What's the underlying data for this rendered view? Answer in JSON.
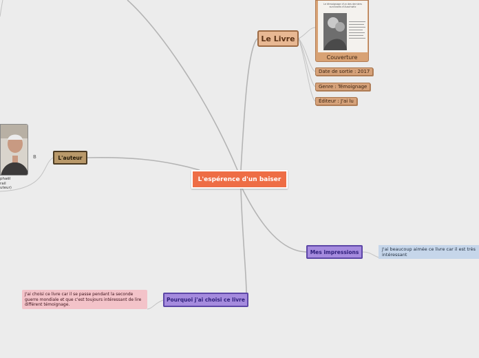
{
  "central": {
    "title": "L'espérence d'un baiser"
  },
  "livre": {
    "title": "Le Livre",
    "cover_label": "Couverture",
    "cover_text": [
      "Le témoignage d'un des derniers",
      "survivants d'Auschwitz"
    ],
    "tags": [
      "Date de sortie : 2017",
      "Genre : Témoignage",
      "Éditeur : J'ai lu"
    ]
  },
  "auteur": {
    "title": "L'auteur",
    "caption": [
      "phaël",
      "rail",
      "uteur)"
    ],
    "fragment": "B"
  },
  "impressions": {
    "title": "Mes impressions",
    "text": "J'ai beaucoup aimée ce livre car il est très intéressant"
  },
  "pourquoi": {
    "title": "Pourquoi j'ai choisi ce livre",
    "text": "J'ai choisi ce livre car il se passe pendant la seconde guerre mondiale et que c'est toujours intéressant de lire différent témoignage."
  },
  "colors": {
    "background": "#ececec",
    "central": "#ee6d45",
    "livre": "#e8b893",
    "auteur": "#b9996a",
    "impressions": "#a58bde",
    "impressions_text": "#c6d6ea",
    "pourquoi_text": "#f3c3c9",
    "connector": "#b4b4b4"
  }
}
